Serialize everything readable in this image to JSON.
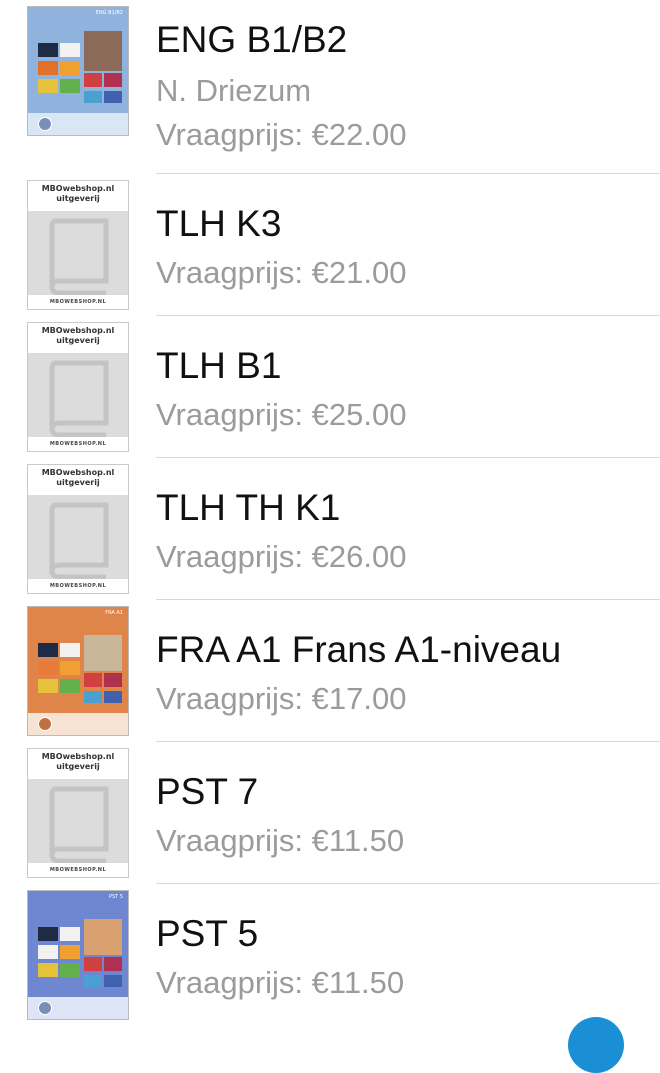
{
  "items": [
    {
      "title": "ENG B1/B2",
      "author": "N. Driezum",
      "price": "Vraagprijs: €22.00",
      "cover": {
        "kind": "illustrated",
        "background": "#8fb3dc",
        "label": "ENG B1/B2",
        "icon": "book-cover-image"
      }
    },
    {
      "title": "TLH K3",
      "price": "Vraagprijs: €21.00",
      "cover": {
        "kind": "placeholder",
        "publisher_line1": "MBOwebshop.nl",
        "publisher_line2": "uitgeverij",
        "footer": "MBOWEBSHOP.NL",
        "icon": "book-placeholder-icon"
      }
    },
    {
      "title": "TLH B1",
      "price": "Vraagprijs: €25.00",
      "cover": {
        "kind": "placeholder",
        "publisher_line1": "MBOwebshop.nl",
        "publisher_line2": "uitgeverij",
        "footer": "MBOWEBSHOP.NL",
        "icon": "book-placeholder-icon"
      }
    },
    {
      "title": "TLH TH K1",
      "price": "Vraagprijs: €26.00",
      "cover": {
        "kind": "placeholder",
        "publisher_line1": "MBOwebshop.nl",
        "publisher_line2": "uitgeverij",
        "footer": "MBOWEBSHOP.NL",
        "icon": "book-placeholder-icon"
      }
    },
    {
      "title": "FRA A1 Frans A1-niveau",
      "price": "Vraagprijs: €17.00",
      "cover": {
        "kind": "illustrated",
        "background": "#e0854a",
        "label": "FRA A1",
        "icon": "book-cover-image"
      }
    },
    {
      "title": "PST 7",
      "price": "Vraagprijs: €11.50",
      "cover": {
        "kind": "placeholder",
        "publisher_line1": "MBOwebshop.nl",
        "publisher_line2": "uitgeverij",
        "footer": "MBOWEBSHOP.NL",
        "icon": "book-placeholder-icon"
      }
    },
    {
      "title": "PST 5",
      "price": "Vraagprijs: €11.50",
      "cover": {
        "kind": "illustrated",
        "background": "#6f86d0",
        "label": "PST 5",
        "icon": "book-cover-image"
      }
    }
  ],
  "colors": {
    "title": "#111111",
    "secondary_text": "#9b9b9b",
    "separator": "#d8d8d8",
    "accent_fab": "#1a8fd6"
  }
}
